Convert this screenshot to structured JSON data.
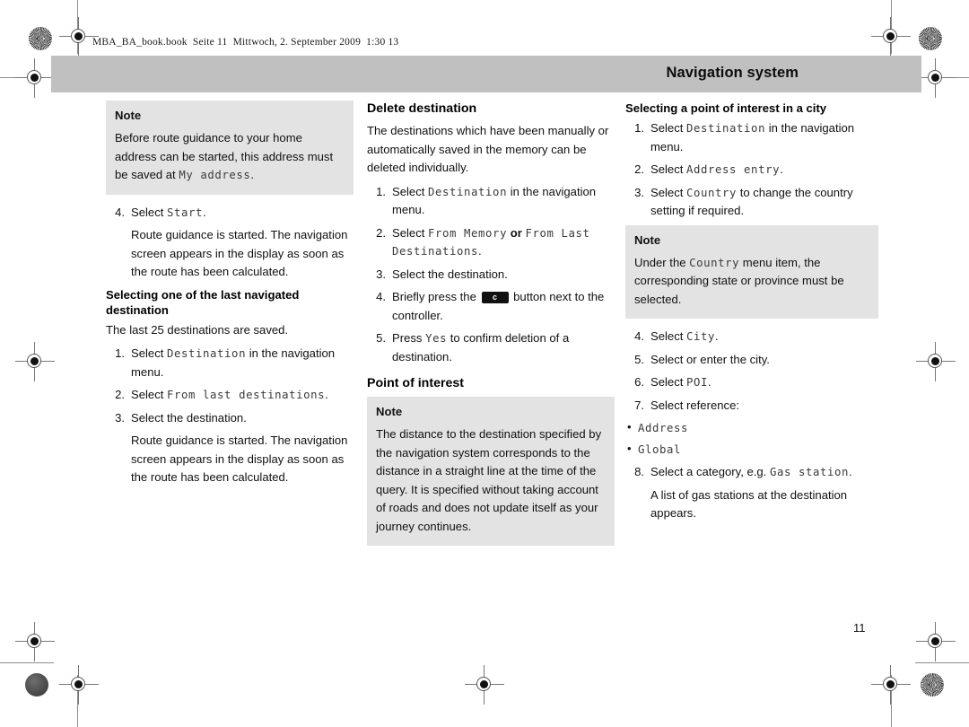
{
  "page": {
    "file_header": "MBA_BA_book.book  Seite 11  Mittwoch, 2. September 2009  1:30 13",
    "running_title": "Navigation system",
    "page_number": "11",
    "title_bar_color": "#c0c0c0",
    "note_box_color": "#e3e3e3"
  },
  "column1": {
    "note": {
      "title": "Note",
      "line1": "Before route guidance to your home",
      "line2": "address can be started, this address",
      "line3_prefix": "must be saved at ",
      "line3_mono": "My address",
      "line3_suffix": "."
    },
    "step4": {
      "num": "4.",
      "prefix": "Select ",
      "mono": "Start",
      "suffix": "."
    },
    "step4_body": "Route guidance is started. The navigation screen appears in the display as soon as the route has been calculated.",
    "subhead": "Selecting one of the last navigated destination",
    "intro": "The last 25 destinations are saved.",
    "steps": [
      {
        "num": "1.",
        "prefix": "Select ",
        "mono": "Destination",
        "suffix": " in the navigation menu."
      },
      {
        "num": "2.",
        "prefix": "Select ",
        "mono": "From last destinations",
        "suffix": "."
      },
      {
        "num": "3.",
        "prefix": "Select the destination.",
        "mono": "",
        "suffix": ""
      }
    ],
    "closing_body": "Route guidance is started. The navigation screen appears in the display as soon as the route has been calculated."
  },
  "column2": {
    "heading": "Delete destination",
    "intro": "The destinations which have been manually or automatically saved in the memory can be deleted individually.",
    "steps": [
      {
        "num": "1.",
        "prefix": "Select ",
        "mono": "Destination",
        "suffix": " in the navigation menu.",
        "mono2": "",
        "mid": "",
        "tail": ""
      },
      {
        "num": "2.",
        "prefix": "Select ",
        "mono": "From Memory",
        "mid": " or ",
        "mono2": "From Last Destinations",
        "suffix": ".",
        "tail": ""
      },
      {
        "num": "3.",
        "prefix": "Select the destination.",
        "mono": "",
        "mid": "",
        "mono2": "",
        "suffix": "",
        "tail": ""
      },
      {
        "num": "4.",
        "prefix": "Briefly press the ",
        "button_label": "c",
        "suffix": " button next to the controller.",
        "mono": "",
        "mid": "",
        "mono2": "",
        "tail": ""
      },
      {
        "num": "5.",
        "prefix": "Press ",
        "mono": "Yes",
        "suffix": " to confirm deletion of a destination.",
        "mid": "",
        "mono2": "",
        "tail": ""
      }
    ],
    "heading2": "Point of interest",
    "note": {
      "title": "Note",
      "body": "The distance to the destination specified by the navigation system corresponds to the distance in a straight line at the time of the query. It is specified without taking account of roads and does not update itself as your journey continues."
    }
  },
  "column3": {
    "subhead": "Selecting a point of interest in a city",
    "steps_top": [
      {
        "num": "1.",
        "prefix": "Select ",
        "mono": "Destination",
        "suffix": " in the navigation menu."
      },
      {
        "num": "2.",
        "prefix": "Select ",
        "mono": "Address entry",
        "suffix": "."
      },
      {
        "num": "3.",
        "prefix": "Select ",
        "mono": "Country",
        "suffix": " to change the country setting if required."
      }
    ],
    "note": {
      "title": "Note",
      "prefix": "Under the ",
      "mono": "Country",
      "suffix": " menu item, the corresponding state or province must be selected."
    },
    "steps_bottom": [
      {
        "num": "4.",
        "prefix": "Select ",
        "mono": "City",
        "suffix": "."
      },
      {
        "num": "5.",
        "prefix": "Select or enter the city.",
        "mono": "",
        "suffix": ""
      },
      {
        "num": "6.",
        "prefix": "Select ",
        "mono": "POI",
        "suffix": "."
      },
      {
        "num": "7.",
        "prefix": "Select reference:",
        "mono": "",
        "suffix": ""
      }
    ],
    "bullets": [
      "Address",
      "Global"
    ],
    "step8": {
      "num": "8.",
      "prefix": "Select a category, e.g.",
      "mono": "Gas station",
      "suffix": "."
    },
    "closing_body": "A list of gas stations at the destination appears."
  }
}
